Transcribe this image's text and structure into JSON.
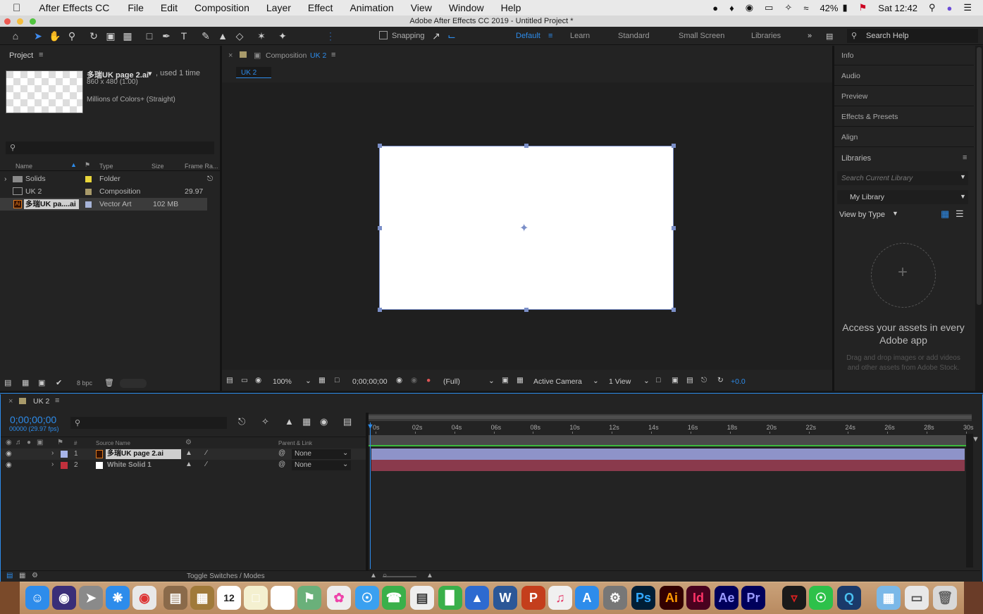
{
  "menubar": {
    "app": "After Effects CC",
    "items": [
      "File",
      "Edit",
      "Composition",
      "Layer",
      "Effect",
      "Animation",
      "View",
      "Window",
      "Help"
    ],
    "battery": "42%",
    "clock": "Sat 12:42"
  },
  "window_title": "Adobe After Effects CC 2019 - Untitled Project *",
  "toolbar": {
    "snapping": "Snapping",
    "workspaces": [
      "Default",
      "Learn",
      "Standard",
      "Small Screen",
      "Libraries"
    ],
    "search_help": "Search Help"
  },
  "project": {
    "title": "Project",
    "item_name": "多瑞UK page 2.ai",
    "item_used": ", used 1 time",
    "item_dims": "860 x 480 (1.00)",
    "item_color": "Millions of Colors+ (Straight)",
    "search_placeholder": "",
    "columns": {
      "name": "Name",
      "type": "Type",
      "size": "Size",
      "frame_rate": "Frame Ra..."
    },
    "rows": [
      {
        "name": "Solids",
        "type": "Folder",
        "size": "",
        "fr": "",
        "color": "#e8d53a"
      },
      {
        "name": "UK 2",
        "type": "Composition",
        "size": "",
        "fr": "29.97",
        "color": "#a89a6a"
      },
      {
        "name": "多瑞UK pa....ai",
        "type": "Vector Art",
        "size": "102 MB",
        "fr": "",
        "color": "#a7b4d8"
      }
    ],
    "bpc": "8 bpc"
  },
  "composition": {
    "tab": "Composition",
    "tab_name": "UK 2",
    "subtab": "UK 2",
    "zoom": "100%",
    "timecode": "0;00;00;00",
    "resolution": "(Full)",
    "camera": "Active Camera",
    "views": "1 View",
    "exposure": "+0.0"
  },
  "right_panel": {
    "items": [
      "Info",
      "Audio",
      "Preview",
      "Effects & Presets",
      "Align"
    ],
    "libraries": "Libraries",
    "search_library_placeholder": "Search Current Library",
    "my_library": "My Library",
    "view_by_type": "View by Type",
    "assets_heading": "Access your assets in every Adobe app",
    "assets_body": "Drag and drop images or add videos and other assets from Adobe Stock."
  },
  "timeline": {
    "tab": "UK 2",
    "timecode": "0;00;00;00",
    "frames": "00000 (29.97 fps)",
    "col_source": "Source Name",
    "col_parent": "Parent & Link",
    "layers": [
      {
        "num": "1",
        "name": "多瑞UK page 2.ai",
        "parent": "None",
        "label": "#a7b4e8",
        "bar": "#8e93c9"
      },
      {
        "num": "2",
        "name": "White Solid 1",
        "parent": "None",
        "label": "#c0303c",
        "bar": "#8a3a4c"
      }
    ],
    "ruler": [
      "0s",
      "02s",
      "04s",
      "06s",
      "08s",
      "10s",
      "12s",
      "14s",
      "16s",
      "18s",
      "20s",
      "22s",
      "24s",
      "26s",
      "28s",
      "30s"
    ],
    "toggle": "Toggle Switches / Modes"
  },
  "dock": {
    "ps": "Ps",
    "ai": "Ai",
    "id": "Id",
    "ae": "Ae",
    "pr": "Pr"
  }
}
